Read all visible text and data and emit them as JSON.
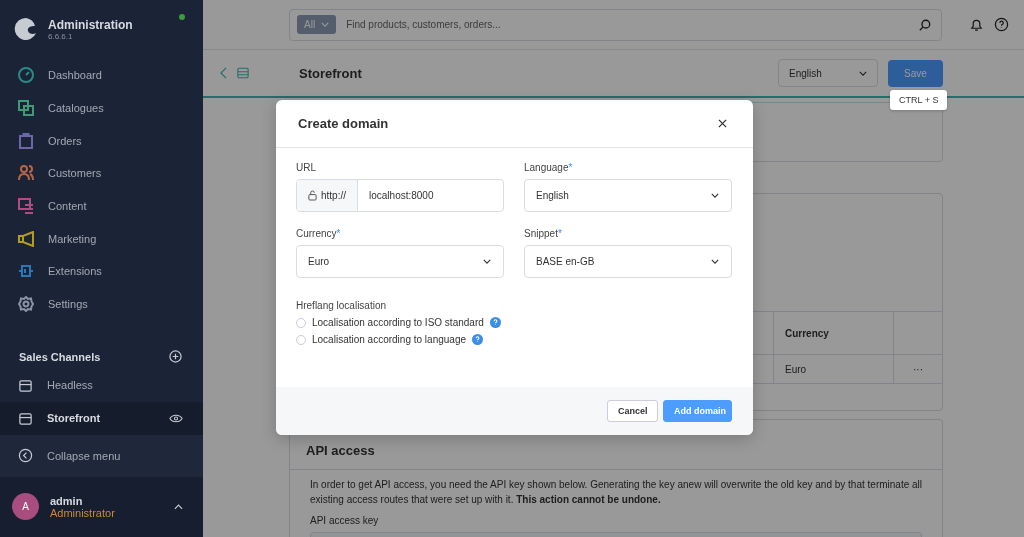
{
  "sidebar": {
    "title": "Administration",
    "version": "6.6.6.1",
    "online": true,
    "items": [
      {
        "label": "Dashboard",
        "color": "#2a8a86"
      },
      {
        "label": "Catalogues",
        "color": "#3f9a78"
      },
      {
        "label": "Orders",
        "color": "#6e66a8"
      },
      {
        "label": "Customers",
        "color": "#b5654a"
      },
      {
        "label": "Content",
        "color": "#b04c85"
      },
      {
        "label": "Marketing",
        "color": "#b59b22"
      },
      {
        "label": "Extensions",
        "color": "#2d76b8"
      },
      {
        "label": "Settings",
        "color": "#8a95a3"
      }
    ],
    "sales_channels_title": "Sales Channels",
    "channels": [
      {
        "label": "Headless",
        "selected": false
      },
      {
        "label": "Storefront",
        "selected": true
      }
    ],
    "collapse": "Collapse menu",
    "user": {
      "initial": "A",
      "name": "admin",
      "role": "Administrator"
    }
  },
  "topbar": {
    "search_filter": "All",
    "search_placeholder": "Find products, customers, orders..."
  },
  "header": {
    "title": "Storefront",
    "language": "English",
    "save": "Save",
    "shortcut": "CTRL + S"
  },
  "table": {
    "columns": [
      "Currency"
    ],
    "rows": [
      [
        "Euro",
        "···"
      ]
    ]
  },
  "api_access": {
    "title": "API access",
    "text": "In order to get API access, you need the API key shown below. Generating the key anew will overwrite the old key and by that terminate all existing access routes that were set up with it. **This action cannot be undone.**",
    "key_label": "API access key"
  },
  "modal": {
    "title": "Create domain",
    "url": {
      "label": "URL",
      "prefix": "http://",
      "value": "localhost:8000"
    },
    "selects": [
      {
        "label": "Language",
        "marker": "*",
        "value": "English"
      },
      {
        "label": "Currency",
        "marker": "*",
        "value": "Euro"
      },
      {
        "label": "Snippet",
        "marker": "*",
        "value": "BASE en-GB"
      }
    ],
    "hreflang": {
      "label": "Hreflang localisation",
      "options": [
        {
          "label": "Localisation according to ISO standard",
          "selected": false
        },
        {
          "label": "Localisation according to language",
          "selected": false
        }
      ]
    },
    "buttons": [
      {
        "label": "Cancel",
        "kind": "secondary"
      },
      {
        "label": "Add domain",
        "kind": "primary"
      }
    ]
  }
}
